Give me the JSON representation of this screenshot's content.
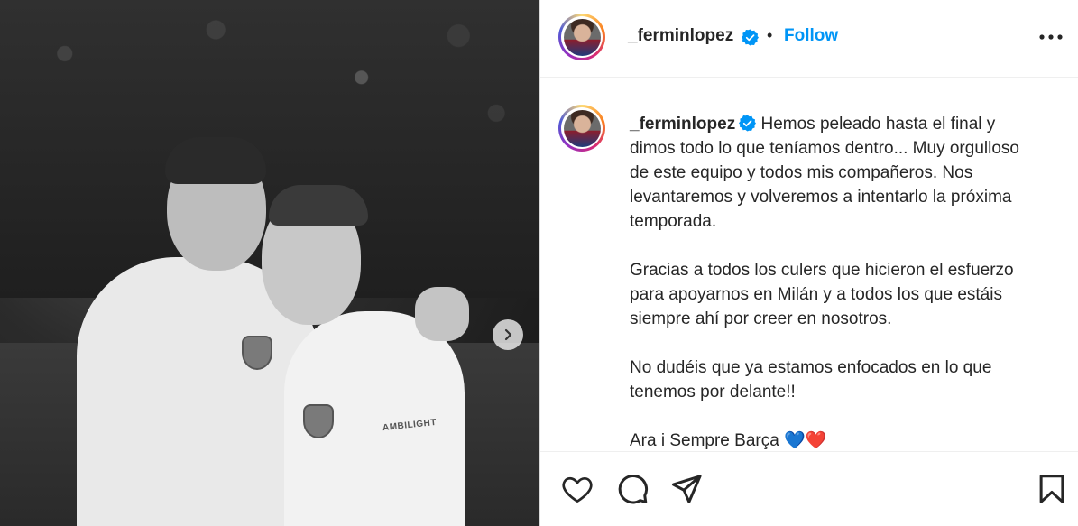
{
  "post": {
    "username": "_ferminlopez",
    "follow_label": "Follow",
    "separator": "•",
    "caption": {
      "username": "_ferminlopez",
      "text": " Hemos peleado hasta el final y\ndimos todo lo que teníamos dentro... Muy orgulloso\nde este equipo y todos mis compañeros. Nos\nlevantaremos y volveremos a intentarlo la próxima\ntemporada.\n\nGracias a todos los culers que hicieron el esfuerzo\npara apoyarnos en Milán y a todos los que estáis\nsiempre ahí por creer en nosotros.\n\nNo dudéis que ya estamos enfocados en lo que\ntenemos por delante!!\n\nAra i Sempre Barça 💙❤️"
    }
  },
  "photo": {
    "sponsor_text": "AMBILIGHT"
  },
  "icons": {
    "verified": "verified-badge-icon",
    "more": "more-options-icon",
    "next": "chevron-right-icon",
    "like": "heart-icon",
    "comment": "comment-icon",
    "share": "paper-plane-icon",
    "save": "bookmark-icon"
  },
  "colors": {
    "follow": "#0095f6",
    "verified": "#0095f6",
    "text": "#262626"
  }
}
